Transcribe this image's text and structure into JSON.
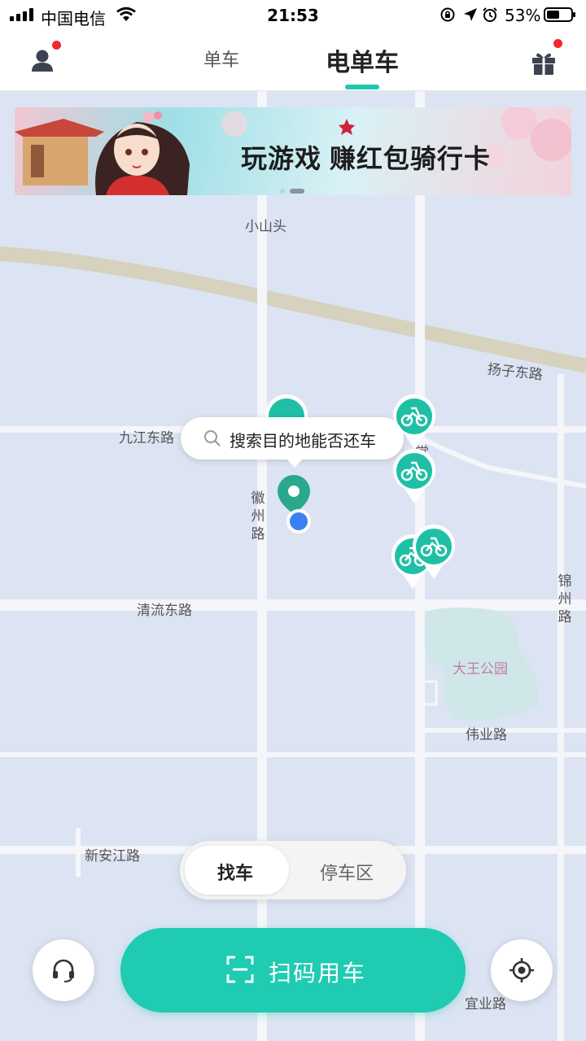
{
  "status_bar": {
    "carrier": "中国电信",
    "time": "21:53",
    "battery_percent": "53%",
    "battery_level": 0.53
  },
  "header": {
    "tabs": [
      {
        "label": "单车",
        "active": false
      },
      {
        "label": "电单车",
        "active": true
      }
    ],
    "accent_color": "#1fc7ad",
    "badge_color": "#f32633"
  },
  "banner": {
    "title": "玩游戏 赚红包骑行卡",
    "page_count": 2,
    "active_page": 1
  },
  "map": {
    "labels": {
      "xiaoshantou": "小山头",
      "yangzi_east_rd": "扬子东路",
      "jiujiang_east_rd": "九江东路",
      "huizhou_rd": "徽州路",
      "qingliu_east_rd": "清流东路",
      "jinzhou_rd": "锦州路",
      "dawang_park": "大王公园",
      "weiye_rd": "伟业路",
      "xinanjiang_rd": "新安江路",
      "yiye_rd": "宜业路",
      "partial_char": "常"
    }
  },
  "search": {
    "label": "搜索目的地能否还车"
  },
  "segment": {
    "find_label": "找车",
    "parking_label": "停车区",
    "active": "找车"
  },
  "actions": {
    "scan_label": "扫码用车",
    "scan_color": "#1fcbb1"
  },
  "icons": {
    "user": "user-icon",
    "gift": "gift-icon",
    "support": "headset-icon",
    "locate": "locate-icon",
    "scan": "scan-frame-icon",
    "bike_marker": "ebike-marker-icon"
  }
}
